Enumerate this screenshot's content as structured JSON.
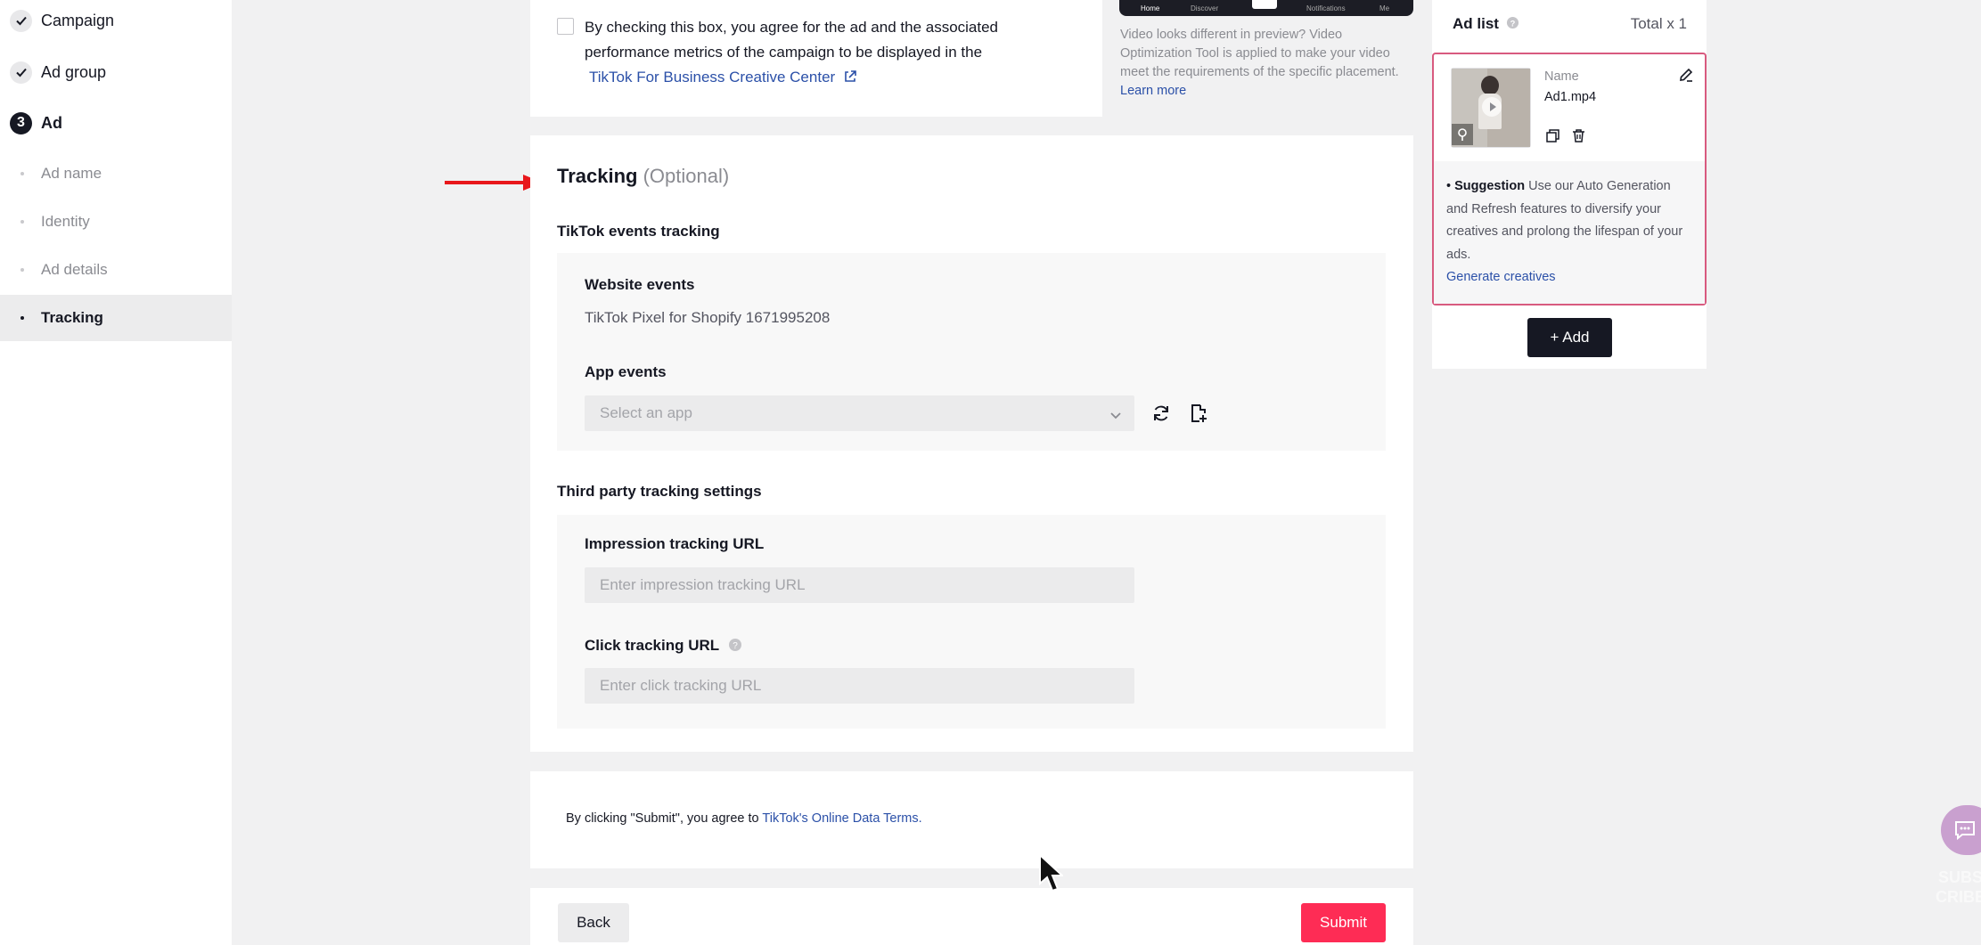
{
  "sidebar": {
    "steps": [
      {
        "label": "Campaign",
        "state": "done"
      },
      {
        "label": "Ad group",
        "state": "done"
      },
      {
        "label": "Ad",
        "state": "current",
        "number": "3"
      }
    ],
    "sub_items": [
      {
        "label": "Ad name"
      },
      {
        "label": "Identity"
      },
      {
        "label": "Ad details"
      },
      {
        "label": "Tracking",
        "active": true
      }
    ]
  },
  "consent": {
    "text_line1": "By checking this box, you agree for the ad and the associated",
    "text_line2": "performance metrics of the campaign to be displayed in the",
    "link": "TikTok For Business Creative Center"
  },
  "preview": {
    "phone_nav": [
      "Home",
      "Discover",
      "Notifications",
      "Me"
    ],
    "note": "Video looks different in preview? Video Optimization Tool is applied to make your video meet the requirements of the specific placement.",
    "learn_more": "Learn more"
  },
  "tracking": {
    "title": "Tracking",
    "optional": "(Optional)",
    "tiktok_events_title": "TikTok events tracking",
    "website_events_label": "Website events",
    "website_events_value": "TikTok Pixel for Shopify 1671995208",
    "app_events_label": "App events",
    "app_select_placeholder": "Select an app",
    "third_party_title": "Third party tracking settings",
    "impression_label": "Impression tracking URL",
    "impression_placeholder": "Enter impression tracking URL",
    "click_label": "Click tracking URL",
    "click_placeholder": "Enter click tracking URL"
  },
  "terms": {
    "text": "By clicking \"Submit\", you agree to",
    "link": "TikTok's Online Data Terms."
  },
  "footer": {
    "back": "Back",
    "submit": "Submit"
  },
  "ad_list": {
    "title": "Ad list",
    "total": "Total x 1",
    "name_label": "Name",
    "name_value": "Ad1.mp4",
    "suggestion_bold": "Suggestion",
    "suggestion_text": " Use our Auto Generation and Refresh features to diversify your creatives and prolong the lifespan of your ads.",
    "generate_link": "Generate creatives",
    "add_button": "+ Add"
  },
  "watermark": {
    "line1": "SUBS",
    "line2": "CRIBE"
  },
  "colors": {
    "accent": "#fe2c55",
    "link": "#2b50a8",
    "arrow": "#e8171b",
    "ad_card_border": "#d85a7f"
  }
}
